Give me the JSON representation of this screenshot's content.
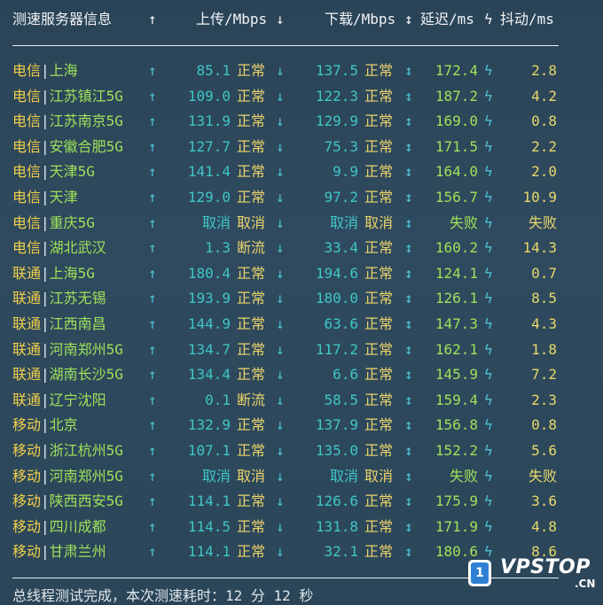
{
  "header": {
    "server": "测速服务器信息",
    "upload_icon": "↑",
    "upload": "上传/Mbps",
    "down_icon": "↓",
    "download": "下载/Mbps",
    "updown_icon": "↕",
    "latency": "延迟/ms",
    "jitter_icon": "ϟ",
    "jitter": "抖动/ms"
  },
  "icons": {
    "up": "↑",
    "down": "↓",
    "updown": "↕",
    "jitter": "ϟ",
    "sep": "|"
  },
  "rows": [
    {
      "isp": "电信",
      "city": "上海",
      "up": "85.1",
      "up_status": "正常",
      "down": "137.5",
      "down_status": "正常",
      "latency": "172.4",
      "jitter": "2.8"
    },
    {
      "isp": "电信",
      "city": "江苏镇江5G",
      "up": "109.0",
      "up_status": "正常",
      "down": "122.3",
      "down_status": "正常",
      "latency": "187.2",
      "jitter": "4.2"
    },
    {
      "isp": "电信",
      "city": "江苏南京5G",
      "up": "131.9",
      "up_status": "正常",
      "down": "129.9",
      "down_status": "正常",
      "latency": "169.0",
      "jitter": "0.8"
    },
    {
      "isp": "电信",
      "city": "安徽合肥5G",
      "up": "127.7",
      "up_status": "正常",
      "down": "75.3",
      "down_status": "正常",
      "latency": "171.5",
      "jitter": "2.2"
    },
    {
      "isp": "电信",
      "city": "天津5G",
      "up": "141.4",
      "up_status": "正常",
      "down": "9.9",
      "down_status": "正常",
      "latency": "164.0",
      "jitter": "2.0"
    },
    {
      "isp": "电信",
      "city": "天津",
      "up": "129.0",
      "up_status": "正常",
      "down": "97.2",
      "down_status": "正常",
      "latency": "156.7",
      "jitter": "10.9"
    },
    {
      "isp": "电信",
      "city": "重庆5G",
      "up": "取消",
      "up_status": "取消",
      "down": "取消",
      "down_status": "取消",
      "latency": "失败",
      "jitter": "失败"
    },
    {
      "isp": "电信",
      "city": "湖北武汉",
      "up": "1.3",
      "up_status": "断流",
      "down": "33.4",
      "down_status": "正常",
      "latency": "160.2",
      "jitter": "14.3"
    },
    {
      "isp": "联通",
      "city": "上海5G",
      "up": "180.4",
      "up_status": "正常",
      "down": "194.6",
      "down_status": "正常",
      "latency": "124.1",
      "jitter": "0.7"
    },
    {
      "isp": "联通",
      "city": "江苏无锡",
      "up": "193.9",
      "up_status": "正常",
      "down": "180.0",
      "down_status": "正常",
      "latency": "126.1",
      "jitter": "8.5"
    },
    {
      "isp": "联通",
      "city": "江西南昌",
      "up": "144.9",
      "up_status": "正常",
      "down": "63.6",
      "down_status": "正常",
      "latency": "147.3",
      "jitter": "4.3"
    },
    {
      "isp": "联通",
      "city": "河南郑州5G",
      "up": "134.7",
      "up_status": "正常",
      "down": "117.2",
      "down_status": "正常",
      "latency": "162.1",
      "jitter": "1.8"
    },
    {
      "isp": "联通",
      "city": "湖南长沙5G",
      "up": "134.4",
      "up_status": "正常",
      "down": "6.6",
      "down_status": "正常",
      "latency": "145.9",
      "jitter": "7.2"
    },
    {
      "isp": "联通",
      "city": "辽宁沈阳",
      "up": "0.1",
      "up_status": "断流",
      "down": "58.5",
      "down_status": "正常",
      "latency": "159.4",
      "jitter": "2.3"
    },
    {
      "isp": "移动",
      "city": "北京",
      "up": "132.9",
      "up_status": "正常",
      "down": "137.9",
      "down_status": "正常",
      "latency": "156.8",
      "jitter": "0.8"
    },
    {
      "isp": "移动",
      "city": "浙江杭州5G",
      "up": "107.1",
      "up_status": "正常",
      "down": "135.0",
      "down_status": "正常",
      "latency": "152.2",
      "jitter": "5.6"
    },
    {
      "isp": "移动",
      "city": "河南郑州5G",
      "up": "取消",
      "up_status": "取消",
      "down": "取消",
      "down_status": "取消",
      "latency": "失败",
      "jitter": "失败"
    },
    {
      "isp": "移动",
      "city": "陕西西安5G",
      "up": "114.1",
      "up_status": "正常",
      "down": "126.6",
      "down_status": "正常",
      "latency": "175.9",
      "jitter": "3.6"
    },
    {
      "isp": "移动",
      "city": "四川成都",
      "up": "114.5",
      "up_status": "正常",
      "down": "131.8",
      "down_status": "正常",
      "latency": "171.9",
      "jitter": "4.8"
    },
    {
      "isp": "移动",
      "city": "甘肃兰州",
      "up": "114.1",
      "up_status": "正常",
      "down": "32.1",
      "down_status": "正常",
      "latency": "180.6",
      "jitter": "8.6"
    }
  ],
  "footer": "总线程测试完成，本次测速耗时：12 分 12 秒",
  "watermark": {
    "badge": "1",
    "brand": "VPSTOP",
    "suffix": ".CN"
  }
}
